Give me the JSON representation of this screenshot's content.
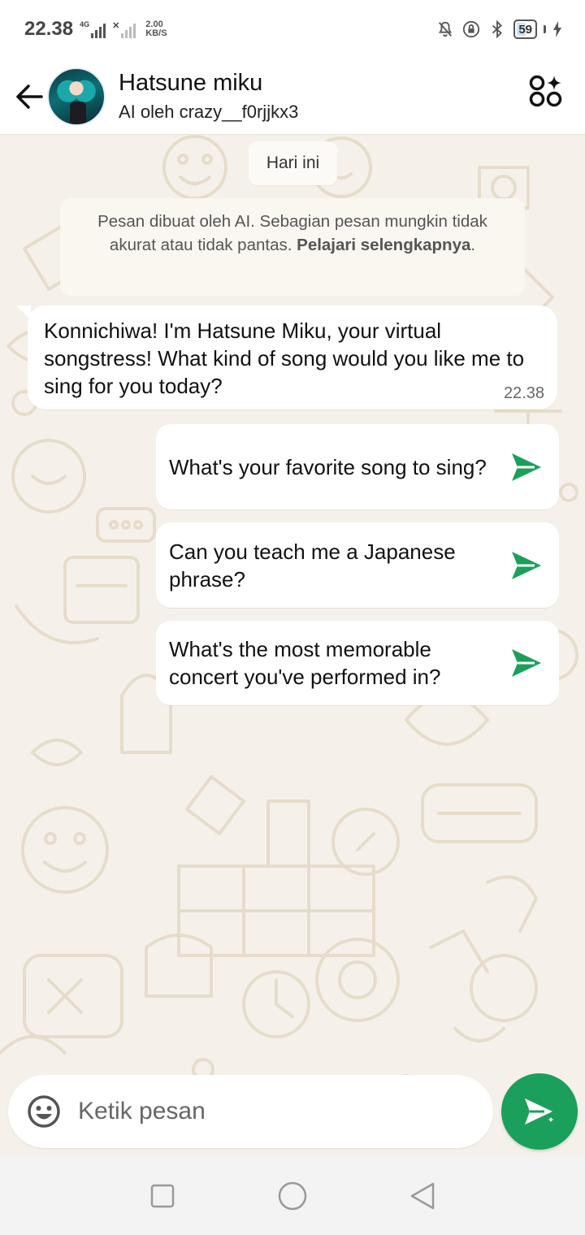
{
  "status_bar": {
    "time": "22.38",
    "network_tag": "4G",
    "speed_value": "2.00",
    "speed_unit": "KB/S",
    "battery_percent": "59",
    "battery_level": 0.59
  },
  "header": {
    "title": "Hatsune miku",
    "subtitle": "AI oleh crazy__f0rjjkx3"
  },
  "chat": {
    "date_label": "Hari ini",
    "ai_notice": {
      "text": "Pesan dibuat oleh AI. Sebagian pesan mungkin tidak akurat atau tidak pantas.",
      "link": "Pelajari selengkapnya",
      "suffix": "."
    },
    "messages": [
      {
        "text": "Konnichiwa! I'm Hatsune Miku, your virtual songstress! What kind of song would you like me to sing for you today?",
        "time": "22.38"
      }
    ],
    "suggestions": [
      "What's your favorite song to sing?",
      "Can you teach me a Japanese phrase?",
      "What's the most memorable concert you've performed in?"
    ]
  },
  "composer": {
    "placeholder": "Ketik pesan",
    "value": ""
  },
  "colors": {
    "accent_green": "#1aa05a",
    "wallpaper": "#f5f1ea",
    "doodle": "#e7dccb"
  },
  "icons": {
    "back": "arrow-left-icon",
    "ai_apps": "circles-sparkle-icon",
    "send": "paper-plane-icon",
    "emoji": "smiley-icon"
  }
}
